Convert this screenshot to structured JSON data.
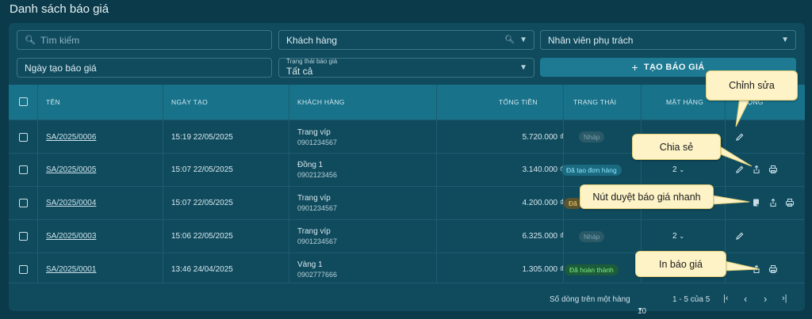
{
  "title": "Danh sách báo giá",
  "filters": {
    "search_placeholder": "Tìm kiếm",
    "customer_label": "Khách hàng",
    "staff_label": "Nhân viên phụ trách",
    "created_date_label": "Ngày tạo báo giá",
    "status_label": "Trạng thái báo giá",
    "status_value": "Tất cả",
    "add_button": "TẠO BÁO GIÁ"
  },
  "table": {
    "headers": {
      "name": "TÊN",
      "created": "NGÀY TẠO",
      "customer": "KHÁCH HÀNG",
      "total": "TỔNG TIỀN",
      "status": "TRẠNG THÁI",
      "items": "MẶT HÀNG",
      "actions": "ĐỘNG"
    },
    "rows": [
      {
        "code": "SA/2025/0006",
        "created": "15:19 22/05/2025",
        "customer": "Trang víp",
        "phone": "0901234567",
        "total": "5.720.000 ₫",
        "status": "Nháp",
        "items": ""
      },
      {
        "code": "SA/2025/0005",
        "created": "15:07 22/05/2025",
        "customer": "Đồng 1",
        "phone": "0902123456",
        "total": "3.140.000 ₫",
        "status": "Đã tạo đơn hàng",
        "items": "2"
      },
      {
        "code": "SA/2025/0004",
        "created": "15:07 22/05/2025",
        "customer": "Trang víp",
        "phone": "0901234567",
        "total": "4.200.000 ₫",
        "status": "Đã",
        "items": ""
      },
      {
        "code": "SA/2025/0003",
        "created": "15:06 22/05/2025",
        "customer": "Trang víp",
        "phone": "0901234567",
        "total": "6.325.000 ₫",
        "status": "Nháp",
        "items": "2"
      },
      {
        "code": "SA/2025/0001",
        "created": "13:46 24/04/2025",
        "customer": "Vàng 1",
        "phone": "0902777666",
        "total": "1.305.000 ₫",
        "status": "Đã hoàn thành",
        "items": ""
      }
    ]
  },
  "pagination": {
    "rows_per_page_label": "Số dòng trên một hàng",
    "rows_per_page": "10",
    "range": "1 - 5 của 5"
  },
  "callouts": {
    "edit": "Chỉnh sửa",
    "share": "Chia sẻ",
    "quick_approve": "Nút duyệt báo giá nhanh",
    "print": "In báo giá"
  },
  "colors": {
    "background": "#0b3a4a",
    "panel": "#0f4a5d",
    "header": "#17728a",
    "accent_button": "#1d7a92",
    "callout": "#fdf3c7"
  }
}
